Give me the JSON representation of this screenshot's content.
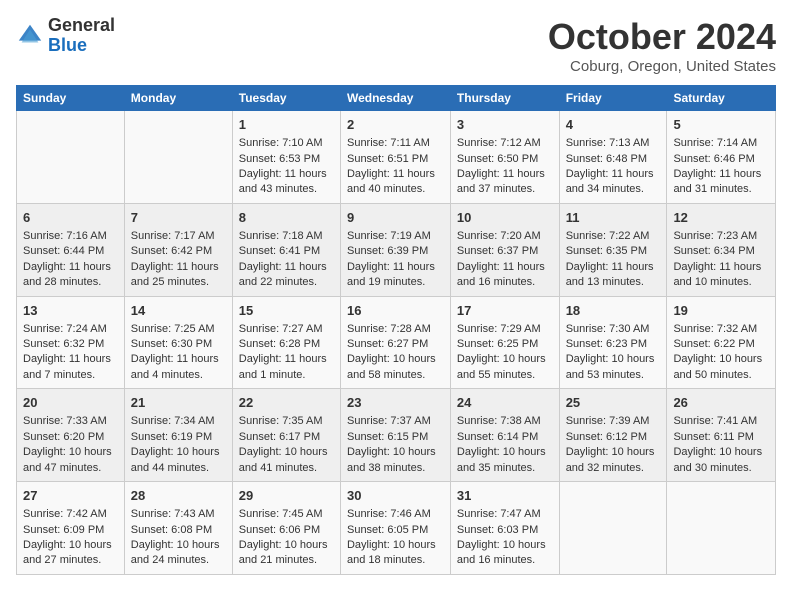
{
  "header": {
    "logo_general": "General",
    "logo_blue": "Blue",
    "month": "October 2024",
    "location": "Coburg, Oregon, United States"
  },
  "weekdays": [
    "Sunday",
    "Monday",
    "Tuesday",
    "Wednesday",
    "Thursday",
    "Friday",
    "Saturday"
  ],
  "weeks": [
    [
      {
        "day": "",
        "info": ""
      },
      {
        "day": "",
        "info": ""
      },
      {
        "day": "1",
        "info": "Sunrise: 7:10 AM\nSunset: 6:53 PM\nDaylight: 11 hours and 43 minutes."
      },
      {
        "day": "2",
        "info": "Sunrise: 7:11 AM\nSunset: 6:51 PM\nDaylight: 11 hours and 40 minutes."
      },
      {
        "day": "3",
        "info": "Sunrise: 7:12 AM\nSunset: 6:50 PM\nDaylight: 11 hours and 37 minutes."
      },
      {
        "day": "4",
        "info": "Sunrise: 7:13 AM\nSunset: 6:48 PM\nDaylight: 11 hours and 34 minutes."
      },
      {
        "day": "5",
        "info": "Sunrise: 7:14 AM\nSunset: 6:46 PM\nDaylight: 11 hours and 31 minutes."
      }
    ],
    [
      {
        "day": "6",
        "info": "Sunrise: 7:16 AM\nSunset: 6:44 PM\nDaylight: 11 hours and 28 minutes."
      },
      {
        "day": "7",
        "info": "Sunrise: 7:17 AM\nSunset: 6:42 PM\nDaylight: 11 hours and 25 minutes."
      },
      {
        "day": "8",
        "info": "Sunrise: 7:18 AM\nSunset: 6:41 PM\nDaylight: 11 hours and 22 minutes."
      },
      {
        "day": "9",
        "info": "Sunrise: 7:19 AM\nSunset: 6:39 PM\nDaylight: 11 hours and 19 minutes."
      },
      {
        "day": "10",
        "info": "Sunrise: 7:20 AM\nSunset: 6:37 PM\nDaylight: 11 hours and 16 minutes."
      },
      {
        "day": "11",
        "info": "Sunrise: 7:22 AM\nSunset: 6:35 PM\nDaylight: 11 hours and 13 minutes."
      },
      {
        "day": "12",
        "info": "Sunrise: 7:23 AM\nSunset: 6:34 PM\nDaylight: 11 hours and 10 minutes."
      }
    ],
    [
      {
        "day": "13",
        "info": "Sunrise: 7:24 AM\nSunset: 6:32 PM\nDaylight: 11 hours and 7 minutes."
      },
      {
        "day": "14",
        "info": "Sunrise: 7:25 AM\nSunset: 6:30 PM\nDaylight: 11 hours and 4 minutes."
      },
      {
        "day": "15",
        "info": "Sunrise: 7:27 AM\nSunset: 6:28 PM\nDaylight: 11 hours and 1 minute."
      },
      {
        "day": "16",
        "info": "Sunrise: 7:28 AM\nSunset: 6:27 PM\nDaylight: 10 hours and 58 minutes."
      },
      {
        "day": "17",
        "info": "Sunrise: 7:29 AM\nSunset: 6:25 PM\nDaylight: 10 hours and 55 minutes."
      },
      {
        "day": "18",
        "info": "Sunrise: 7:30 AM\nSunset: 6:23 PM\nDaylight: 10 hours and 53 minutes."
      },
      {
        "day": "19",
        "info": "Sunrise: 7:32 AM\nSunset: 6:22 PM\nDaylight: 10 hours and 50 minutes."
      }
    ],
    [
      {
        "day": "20",
        "info": "Sunrise: 7:33 AM\nSunset: 6:20 PM\nDaylight: 10 hours and 47 minutes."
      },
      {
        "day": "21",
        "info": "Sunrise: 7:34 AM\nSunset: 6:19 PM\nDaylight: 10 hours and 44 minutes."
      },
      {
        "day": "22",
        "info": "Sunrise: 7:35 AM\nSunset: 6:17 PM\nDaylight: 10 hours and 41 minutes."
      },
      {
        "day": "23",
        "info": "Sunrise: 7:37 AM\nSunset: 6:15 PM\nDaylight: 10 hours and 38 minutes."
      },
      {
        "day": "24",
        "info": "Sunrise: 7:38 AM\nSunset: 6:14 PM\nDaylight: 10 hours and 35 minutes."
      },
      {
        "day": "25",
        "info": "Sunrise: 7:39 AM\nSunset: 6:12 PM\nDaylight: 10 hours and 32 minutes."
      },
      {
        "day": "26",
        "info": "Sunrise: 7:41 AM\nSunset: 6:11 PM\nDaylight: 10 hours and 30 minutes."
      }
    ],
    [
      {
        "day": "27",
        "info": "Sunrise: 7:42 AM\nSunset: 6:09 PM\nDaylight: 10 hours and 27 minutes."
      },
      {
        "day": "28",
        "info": "Sunrise: 7:43 AM\nSunset: 6:08 PM\nDaylight: 10 hours and 24 minutes."
      },
      {
        "day": "29",
        "info": "Sunrise: 7:45 AM\nSunset: 6:06 PM\nDaylight: 10 hours and 21 minutes."
      },
      {
        "day": "30",
        "info": "Sunrise: 7:46 AM\nSunset: 6:05 PM\nDaylight: 10 hours and 18 minutes."
      },
      {
        "day": "31",
        "info": "Sunrise: 7:47 AM\nSunset: 6:03 PM\nDaylight: 10 hours and 16 minutes."
      },
      {
        "day": "",
        "info": ""
      },
      {
        "day": "",
        "info": ""
      }
    ]
  ]
}
